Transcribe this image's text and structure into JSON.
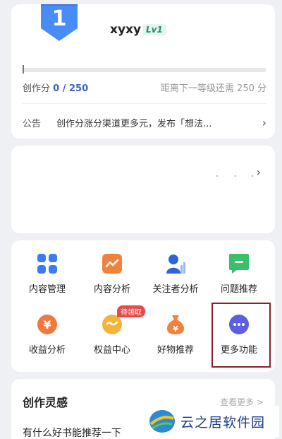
{
  "profile": {
    "rank_badge": "1",
    "username": "xyxy",
    "level": "Lv1",
    "progress_fraction": 0.0,
    "score_label": "创作分",
    "score_value": "0 / 250",
    "next_level_text": "距离下一等级还需 250 分",
    "notice_tag": "公告",
    "notice_text": "创作分涨分渠道更多元，发布「想法..."
  },
  "functions": [
    {
      "label": "内容管理",
      "icon": "grid-icon",
      "color": "#3d7cf0"
    },
    {
      "label": "内容分析",
      "icon": "trend-chart-icon",
      "color": "#f0823d"
    },
    {
      "label": "关注者分析",
      "icon": "follower-chart-icon",
      "color": "#2f63d9"
    },
    {
      "label": "问题推荐",
      "icon": "chat-bubble-icon",
      "color": "#3bbf6a"
    },
    {
      "label": "收益分析",
      "icon": "yuan-coin-icon",
      "color": "#f07a3d"
    },
    {
      "label": "权益中心",
      "icon": "smile-badge-icon",
      "color": "#f5b33d"
    },
    {
      "label": "好物推荐",
      "icon": "money-bag-icon",
      "color": "#f0823d"
    },
    {
      "label": "更多功能",
      "icon": "more-dots-icon",
      "color": "#5b5fe0"
    }
  ],
  "pending_tag": "待领取",
  "inspiration": {
    "title": "创作灵感",
    "more_link": "查看更多 >",
    "first_item": "有什么好书能推荐一下"
  },
  "watermark": {
    "text": "云之居软件园"
  }
}
